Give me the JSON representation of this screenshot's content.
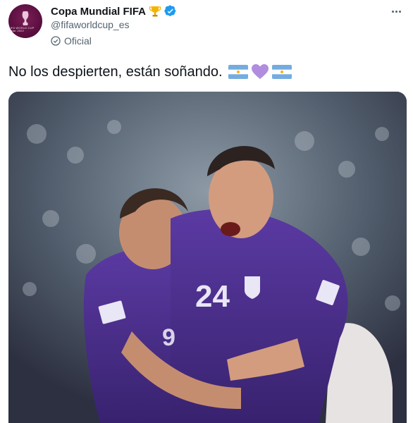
{
  "account": {
    "display_name": "Copa Mundial FIFA",
    "handle": "@fifaworldcup_es",
    "label": "Oficial",
    "avatar_text": "FIFA WORLD CUP Qatar 2022"
  },
  "tweet": {
    "text": "No los despierten, están soñando.",
    "emojis": [
      "flag-argentina-icon",
      "purple-heart-icon",
      "flag-argentina-icon"
    ]
  },
  "media": {
    "jersey_numbers": [
      "24",
      "9"
    ]
  },
  "colors": {
    "text_primary": "#0f1419",
    "text_secondary": "#536471",
    "verified_blue": "#1d9bf0",
    "jersey_purple": "#4b2d8f",
    "heart_purple": "#b18ddf",
    "flag_blue": "#74acdf"
  }
}
